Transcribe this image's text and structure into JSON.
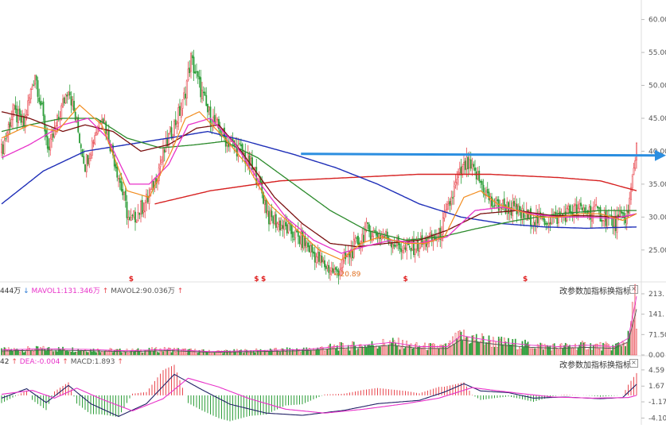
{
  "colors": {
    "up": "#e8474f",
    "down": "#2e9e3a",
    "ma5": "#333333",
    "ma10": "#f28c1e",
    "ma20": "#e832c9",
    "ma30": "#7a1010",
    "ma60": "#2b8a2b",
    "ma120": "#1f2fb8",
    "ma250": "#d62020",
    "arrow": "#2b8ee0",
    "axis_text": "#555555",
    "grid": "#eeeeee"
  },
  "price_axis": {
    "ticks": [
      "60.00",
      "55.00",
      "50.00",
      "45.00",
      "40.00",
      "35.00",
      "30.00",
      "25.00"
    ],
    "range": [
      21,
      62
    ]
  },
  "low_label": "←20.89",
  "event_marker": "$",
  "volume_panel": {
    "legend": {
      "vol_value": "444万",
      "mavol1_label": "MAVOL1:131.346万",
      "mavol2_label": "MAVOL2:90.036万"
    },
    "axis_ticks": [
      "213.",
      "141.",
      "71.50",
      "0.00"
    ],
    "range": [
      0,
      230
    ],
    "buttons": [
      "改参数",
      "加指标",
      "换指标"
    ]
  },
  "macd_panel": {
    "legend": {
      "dif_value": "42",
      "dea_label": "DEA:-0.004",
      "macd_label": "MACD:1.893"
    },
    "axis_ticks": [
      "4.59",
      "1.67",
      "-1.17",
      "-4.10"
    ],
    "range": [
      -4.6,
      5.0
    ],
    "buttons": [
      "改参数",
      "加指标",
      "换指标"
    ]
  },
  "close_icon": "×",
  "chart_data": {
    "type": "candlestick",
    "price_ylim": [
      21,
      62
    ],
    "control_points": {
      "close": [
        [
          0,
          40
        ],
        [
          8,
          46
        ],
        [
          16,
          44
        ],
        [
          24,
          52
        ],
        [
          34,
          40
        ],
        [
          48,
          50
        ],
        [
          60,
          38
        ],
        [
          72,
          46
        ],
        [
          82,
          38
        ],
        [
          92,
          29
        ],
        [
          106,
          33
        ],
        [
          120,
          42
        ],
        [
          130,
          47
        ],
        [
          136,
          54
        ],
        [
          148,
          46
        ],
        [
          160,
          42
        ],
        [
          172,
          40
        ],
        [
          184,
          36
        ],
        [
          192,
          30
        ],
        [
          206,
          28
        ],
        [
          218,
          26
        ],
        [
          230,
          23
        ],
        [
          240,
          21.5
        ],
        [
          252,
          25
        ],
        [
          262,
          28
        ],
        [
          276,
          27
        ],
        [
          290,
          25
        ],
        [
          302,
          26
        ],
        [
          314,
          27
        ],
        [
          328,
          36
        ],
        [
          334,
          38
        ],
        [
          342,
          36
        ],
        [
          352,
          32
        ],
        [
          364,
          31.5
        ],
        [
          376,
          30
        ],
        [
          388,
          29.5
        ],
        [
          400,
          30
        ],
        [
          410,
          31
        ],
        [
          420,
          31
        ],
        [
          430,
          30.5
        ],
        [
          440,
          29
        ],
        [
          450,
          30.5
        ],
        [
          456,
          41
        ]
      ],
      "ma5": [
        [
          0,
          40
        ],
        [
          8,
          45
        ],
        [
          16,
          44
        ],
        [
          24,
          50
        ],
        [
          34,
          42
        ],
        [
          48,
          49
        ],
        [
          60,
          39
        ],
        [
          72,
          45
        ],
        [
          82,
          39
        ],
        [
          92,
          31
        ],
        [
          106,
          33
        ],
        [
          120,
          41
        ],
        [
          130,
          46
        ],
        [
          136,
          51
        ],
        [
          148,
          46
        ],
        [
          160,
          42
        ],
        [
          172,
          40
        ],
        [
          184,
          35
        ],
        [
          192,
          31
        ],
        [
          206,
          28
        ],
        [
          218,
          26.5
        ],
        [
          230,
          24
        ],
        [
          240,
          22.5
        ],
        [
          252,
          25
        ],
        [
          262,
          27.5
        ],
        [
          276,
          27
        ],
        [
          290,
          25.5
        ],
        [
          302,
          26
        ],
        [
          314,
          27
        ],
        [
          328,
          34
        ],
        [
          334,
          36
        ],
        [
          342,
          35
        ],
        [
          352,
          32.5
        ],
        [
          364,
          31.5
        ],
        [
          376,
          30.5
        ],
        [
          388,
          30
        ],
        [
          400,
          30.2
        ],
        [
          410,
          31
        ],
        [
          420,
          31
        ],
        [
          430,
          30.5
        ],
        [
          440,
          29.5
        ],
        [
          450,
          30
        ],
        [
          456,
          32.5
        ]
      ],
      "ma10": [
        [
          0,
          42
        ],
        [
          20,
          44
        ],
        [
          40,
          43
        ],
        [
          56,
          47
        ],
        [
          72,
          44
        ],
        [
          90,
          34
        ],
        [
          106,
          33
        ],
        [
          122,
          40
        ],
        [
          132,
          45
        ],
        [
          142,
          46
        ],
        [
          160,
          42
        ],
        [
          176,
          38
        ],
        [
          192,
          32
        ],
        [
          210,
          28.5
        ],
        [
          228,
          25
        ],
        [
          244,
          23.5
        ],
        [
          258,
          26
        ],
        [
          272,
          27
        ],
        [
          290,
          26
        ],
        [
          304,
          26
        ],
        [
          318,
          27
        ],
        [
          332,
          33
        ],
        [
          344,
          34
        ],
        [
          356,
          32
        ],
        [
          370,
          31
        ],
        [
          386,
          30
        ],
        [
          400,
          30
        ],
        [
          416,
          30.5
        ],
        [
          430,
          30.5
        ],
        [
          446,
          29.5
        ],
        [
          456,
          30.5
        ]
      ],
      "ma20": [
        [
          0,
          39
        ],
        [
          20,
          41
        ],
        [
          44,
          44
        ],
        [
          62,
          45
        ],
        [
          76,
          42
        ],
        [
          92,
          35
        ],
        [
          106,
          35
        ],
        [
          120,
          38
        ],
        [
          134,
          44
        ],
        [
          150,
          45
        ],
        [
          168,
          41
        ],
        [
          186,
          35
        ],
        [
          204,
          30
        ],
        [
          224,
          26.5
        ],
        [
          244,
          24.5
        ],
        [
          260,
          25.5
        ],
        [
          280,
          26.5
        ],
        [
          300,
          26
        ],
        [
          320,
          27
        ],
        [
          340,
          31
        ],
        [
          360,
          31.5
        ],
        [
          380,
          30.5
        ],
        [
          400,
          30
        ],
        [
          420,
          30
        ],
        [
          440,
          29.8
        ],
        [
          456,
          30.5
        ]
      ],
      "ma30": [
        [
          0,
          46
        ],
        [
          20,
          45
        ],
        [
          44,
          43
        ],
        [
          60,
          44
        ],
        [
          80,
          43
        ],
        [
          100,
          40
        ],
        [
          120,
          41
        ],
        [
          140,
          43.5
        ],
        [
          156,
          44
        ],
        [
          172,
          40
        ],
        [
          196,
          33
        ],
        [
          216,
          29
        ],
        [
          236,
          26
        ],
        [
          256,
          25.5
        ],
        [
          276,
          26
        ],
        [
          300,
          26.5
        ],
        [
          320,
          28
        ],
        [
          344,
          30.5
        ],
        [
          370,
          31
        ],
        [
          396,
          30.2
        ],
        [
          420,
          30.2
        ],
        [
          446,
          30
        ],
        [
          456,
          30.5
        ]
      ],
      "ma60": [
        [
          0,
          43
        ],
        [
          20,
          44
        ],
        [
          44,
          45
        ],
        [
          68,
          45
        ],
        [
          90,
          42
        ],
        [
          114,
          40.5
        ],
        [
          140,
          41
        ],
        [
          160,
          41.5
        ],
        [
          184,
          39
        ],
        [
          210,
          35
        ],
        [
          236,
          31
        ],
        [
          262,
          28
        ],
        [
          290,
          26.5
        ],
        [
          316,
          27
        ],
        [
          340,
          28.2
        ],
        [
          370,
          29.5
        ],
        [
          400,
          30.5
        ],
        [
          430,
          31
        ],
        [
          456,
          31
        ]
      ],
      "ma120": [
        [
          0,
          32
        ],
        [
          30,
          37
        ],
        [
          60,
          40
        ],
        [
          90,
          41
        ],
        [
          120,
          42
        ],
        [
          148,
          43
        ],
        [
          176,
          41.5
        ],
        [
          210,
          39.5
        ],
        [
          240,
          37.5
        ],
        [
          270,
          35
        ],
        [
          300,
          32
        ],
        [
          330,
          30
        ],
        [
          360,
          29
        ],
        [
          390,
          28.5
        ],
        [
          420,
          28.3
        ],
        [
          456,
          28.5
        ]
      ],
      "ma250": [
        [
          110,
          32
        ],
        [
          150,
          34
        ],
        [
          200,
          35.5
        ],
        [
          250,
          36
        ],
        [
          300,
          36.5
        ],
        [
          350,
          36.5
        ],
        [
          400,
          36
        ],
        [
          430,
          35.5
        ],
        [
          456,
          34
        ]
      ],
      "volume": [
        [
          0,
          18
        ],
        [
          30,
          22
        ],
        [
          60,
          20
        ],
        [
          90,
          15
        ],
        [
          120,
          20
        ],
        [
          150,
          12
        ],
        [
          180,
          15
        ],
        [
          220,
          20
        ],
        [
          240,
          30
        ],
        [
          260,
          35
        ],
        [
          280,
          45
        ],
        [
          300,
          30
        ],
        [
          320,
          30
        ],
        [
          330,
          70
        ],
        [
          340,
          60
        ],
        [
          360,
          45
        ],
        [
          380,
          35
        ],
        [
          400,
          30
        ],
        [
          420,
          35
        ],
        [
          440,
          30
        ],
        [
          450,
          60
        ],
        [
          456,
          210
        ]
      ],
      "dif": [
        [
          0,
          -0.5
        ],
        [
          18,
          1.2
        ],
        [
          32,
          -1.3
        ],
        [
          48,
          1.8
        ],
        [
          64,
          -1.5
        ],
        [
          84,
          -3.8
        ],
        [
          104,
          -1.5
        ],
        [
          124,
          3.8
        ],
        [
          144,
          1.0
        ],
        [
          164,
          -1.6
        ],
        [
          190,
          -3.2
        ],
        [
          216,
          -3.6
        ],
        [
          246,
          -2.7
        ],
        [
          270,
          -1.5
        ],
        [
          300,
          -0.9
        ],
        [
          318,
          0.6
        ],
        [
          332,
          2.1
        ],
        [
          344,
          0.8
        ],
        [
          364,
          0.5
        ],
        [
          382,
          -0.5
        ],
        [
          404,
          -0.3
        ],
        [
          430,
          -0.6
        ],
        [
          446,
          -0.4
        ],
        [
          456,
          2.0
        ]
      ],
      "dea": [
        [
          0,
          0.2
        ],
        [
          22,
          0.9
        ],
        [
          38,
          -0.5
        ],
        [
          54,
          1.3
        ],
        [
          72,
          -0.7
        ],
        [
          94,
          -2.8
        ],
        [
          116,
          -0.6
        ],
        [
          134,
          3.1
        ],
        [
          156,
          1.5
        ],
        [
          178,
          -0.6
        ],
        [
          204,
          -2.5
        ],
        [
          232,
          -3.2
        ],
        [
          260,
          -2.5
        ],
        [
          290,
          -1.5
        ],
        [
          314,
          -0.5
        ],
        [
          338,
          1.4
        ],
        [
          354,
          0.9
        ],
        [
          374,
          0.3
        ],
        [
          396,
          -0.3
        ],
        [
          424,
          -0.5
        ],
        [
          450,
          -0.4
        ],
        [
          456,
          -0.004
        ]
      ]
    },
    "bars": 457,
    "event_marker_bars": [
      93,
      183,
      188,
      290,
      376
    ],
    "low_point": {
      "bar": 240,
      "value": 20.89
    },
    "arrow_level": 39.6
  }
}
